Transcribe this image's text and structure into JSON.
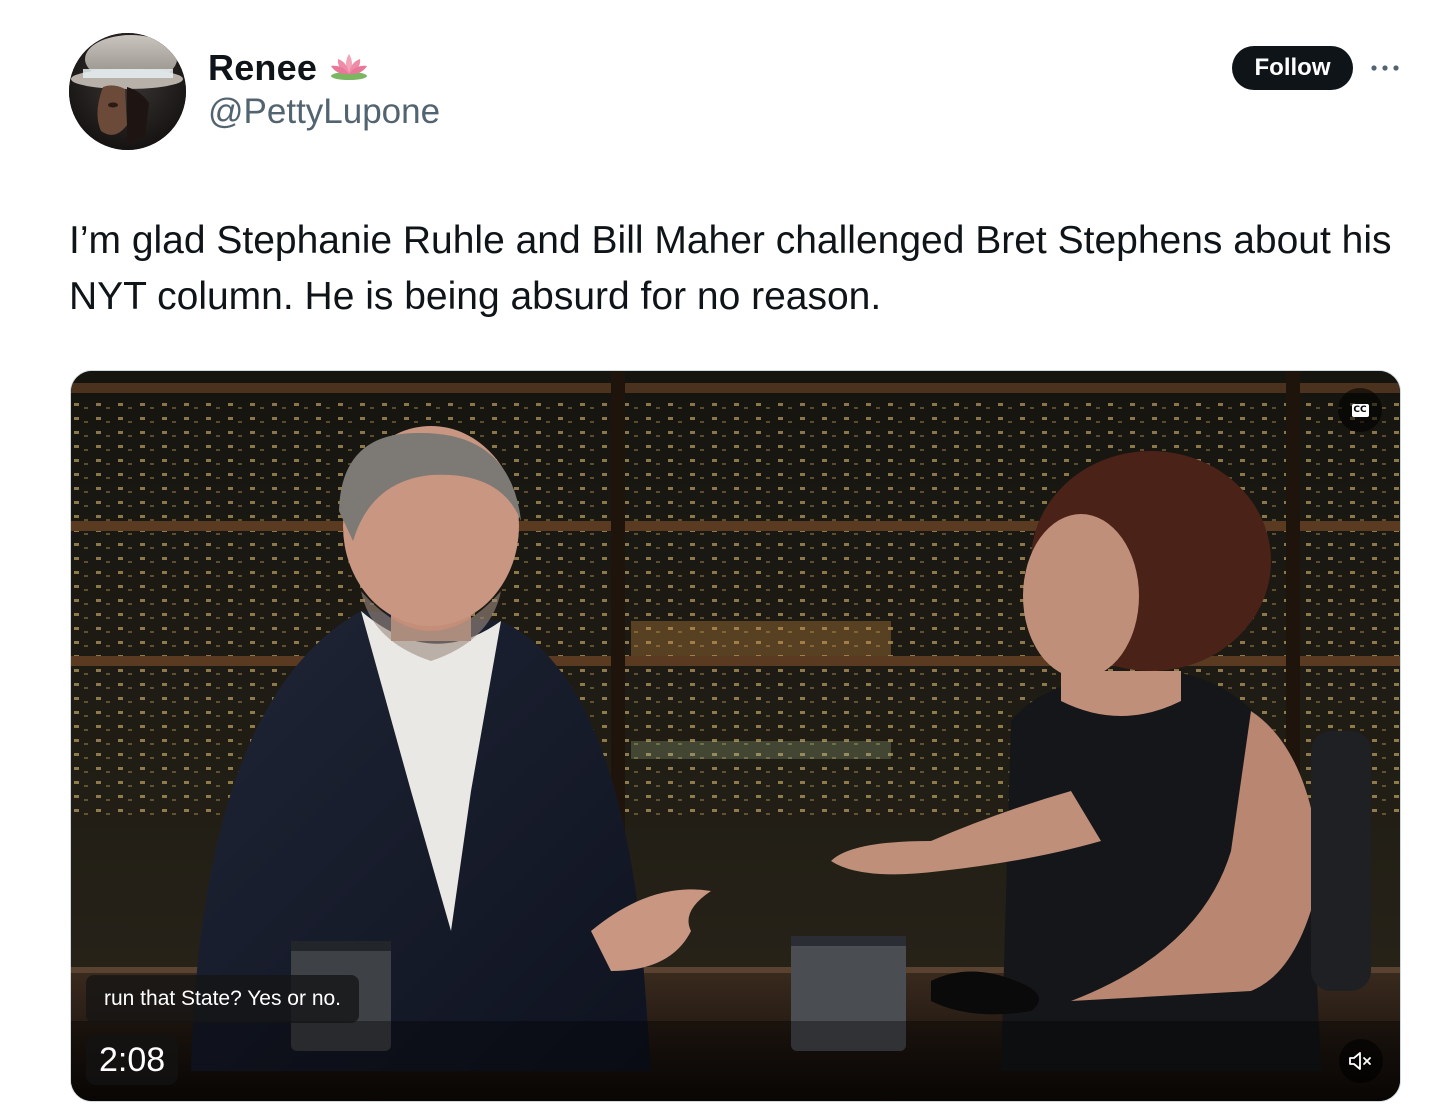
{
  "author": {
    "display_name": "Renee",
    "name_emoji_icon": "lotus-icon",
    "handle": "@PettyLupone"
  },
  "actions": {
    "follow_label": "Follow",
    "more_icon": "more-dots-icon"
  },
  "tweet": {
    "text": "I’m glad Stephanie Ruhle and Bill Maher challenged Bret Stephens about his NYT column. He is being absurd for no reason."
  },
  "video": {
    "caption": "run that State? Yes or no.",
    "timestamp": "2:08",
    "cc_icon": "closed-captions-icon",
    "cc_label": "CC",
    "mute_icon": "muted-speaker-icon"
  },
  "colors": {
    "text_primary": "#0f1419",
    "text_secondary": "#536471",
    "follow_bg": "#0f1419",
    "follow_text": "#ffffff",
    "media_border": "#cfd9de"
  }
}
